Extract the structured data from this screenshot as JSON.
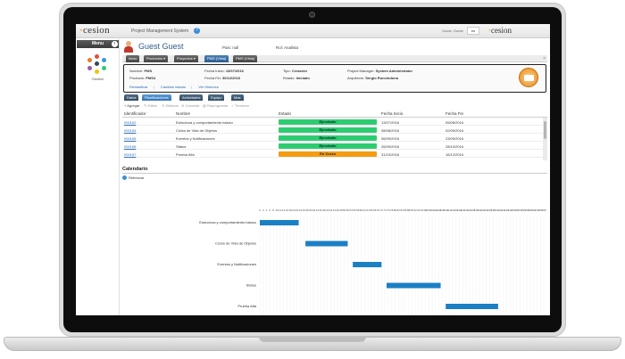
{
  "app": {
    "logo_text": "cesion",
    "system_name": "Project Management System",
    "user_short": "Guest, Guest",
    "lang": "es",
    "logo_right": "cesion"
  },
  "sidebar": {
    "menu_label": "Menu",
    "module_label": "Gestión"
  },
  "user": {
    "name": "Guest Guest",
    "pais_label": "Pais:",
    "pais_value": "null",
    "rol_label": "Rol:",
    "rol_value": "Analista"
  },
  "tabs": [
    {
      "label": "Inicio"
    },
    {
      "label": "Productos ▾"
    },
    {
      "label": "Proyectos ▾"
    },
    {
      "label": "PMS (Vista)"
    },
    {
      "label": "PMS (Vista)"
    }
  ],
  "project": {
    "nombre_label": "Nombre:",
    "nombre": "PMS",
    "producto_label": "Producto:",
    "producto": "PMS4",
    "fecha_inicio_label": "Fecha Inicio:",
    "fecha_inicio": "13/07/2016",
    "fecha_fin_label": "Fecha Fin:",
    "fecha_fin": "30/12/2016",
    "tipo_label": "Tipo:",
    "tipo": "Creación",
    "estado_label": "Estado:",
    "estado": "Iniciado",
    "pm_label": "Project Manager:",
    "pm": "System Administrator",
    "arquitecto_label": "Arquitecto:",
    "arquitecto": "Sergio Runcindona",
    "links": [
      "Reclasificar",
      "Cambiar estado",
      "Ver Histórico"
    ]
  },
  "subtabs": [
    {
      "label": "Datos"
    },
    {
      "label": "Planificaciones"
    },
    {
      "label": "Actividades"
    },
    {
      "label": "Equipo"
    },
    {
      "label": "Mas"
    }
  ],
  "toolbar": {
    "agregar": "Agregar",
    "editar": "Editar",
    "eliminar": "Eliminar",
    "cancelar": "Cancelar",
    "reprogramar": "Reprogramar",
    "terminar": "Terminar"
  },
  "grid": {
    "headers": [
      "Identificador",
      "Nombre",
      "Estado",
      "Fecha Inicio",
      "Fecha Fin"
    ],
    "rows": [
      {
        "id": "000162",
        "nombre": "Estructura y comportamiento básico",
        "estado": "Ejecutado",
        "inicio": "13/07/2016",
        "fin": "05/08/2016"
      },
      {
        "id": "000164",
        "nombre": "Ciclos de Vida de Objetos",
        "estado": "Ejecutado",
        "inicio": "08/08/2016",
        "fin": "02/09/2016"
      },
      {
        "id": "000165",
        "nombre": "Eventos y Notificaciones",
        "estado": "Ejecutado",
        "inicio": "06/09/2016",
        "fin": "23/09/2016"
      },
      {
        "id": "000166",
        "nombre": "Status",
        "estado": "Ejecutado",
        "inicio": "26/09/2016",
        "fin": "28/10/2016"
      },
      {
        "id": "000167",
        "nombre": "Prueba Alfa",
        "estado": "En Curso",
        "inicio": "31/10/2016",
        "fin": "16/12/2016"
      }
    ]
  },
  "calendar": {
    "title": "Calendario",
    "refresh_label": "Refrescar"
  },
  "colors": {
    "ejecutado": "#2ecc71",
    "en_curso": "#f39c12",
    "gantt_bar": "#1b7fc4",
    "accent": "#2f5d8a"
  },
  "chart_data": {
    "type": "gantt",
    "axis_ticks_start": 0,
    "axis_ticks_end": 168,
    "tasks": [
      {
        "name": "Estructura y comportamiento básico",
        "start": 0,
        "end": 23
      },
      {
        "name": "Ciclos de Vida de Objetos",
        "start": 27,
        "end": 52
      },
      {
        "name": "Eventos y Notificaciones",
        "start": 55,
        "end": 72
      },
      {
        "name": "Status",
        "start": 75,
        "end": 107
      },
      {
        "name": "Prueba Alfa",
        "start": 110,
        "end": 141
      },
      {
        "name": "Prueba Beta",
        "start": 144,
        "end": 168
      }
    ]
  }
}
